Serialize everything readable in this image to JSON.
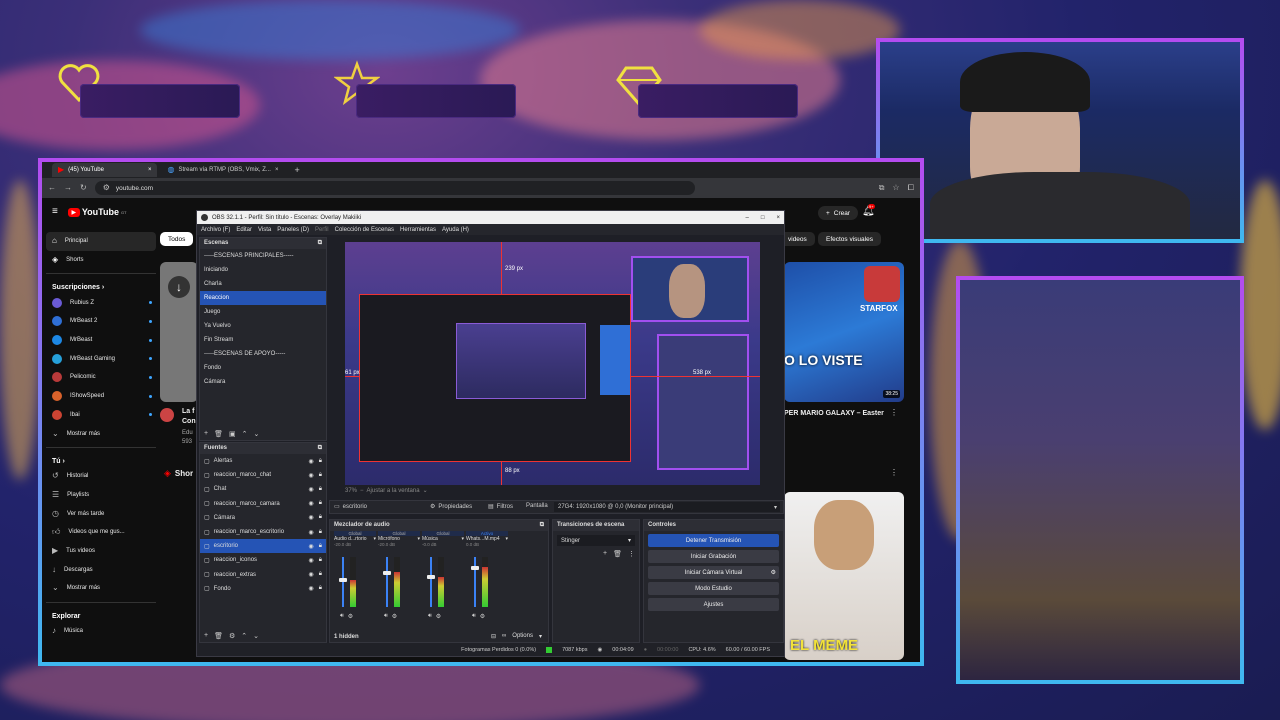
{
  "overlay": {
    "icons": [
      "heart-icon",
      "star-icon",
      "diamond-icon"
    ],
    "accent_purple": "#b44cf0",
    "accent_blue": "#3fb8f0"
  },
  "browser": {
    "tabs": [
      {
        "label": "(45) YouTube",
        "close": "×"
      },
      {
        "label": "Stream vía RTMP (OBS, Vmix, Z...",
        "close": "×"
      }
    ],
    "new_tab": "+",
    "url": "youtube.com"
  },
  "youtube": {
    "logo": "YouTube",
    "logo_sup": "GT",
    "create_label": "Crear",
    "notif_count": "9+",
    "nav": [
      {
        "label": "Principal",
        "icon": "home-icon"
      },
      {
        "label": "Shorts",
        "icon": "shorts-icon"
      }
    ],
    "subs_heading": "Suscripciones",
    "subs": [
      {
        "label": "Rubius Z",
        "color": "#6b5bd6"
      },
      {
        "label": "MrBeast 2",
        "color": "#2f6fd6"
      },
      {
        "label": "MrBeast",
        "color": "#1d88e5"
      },
      {
        "label": "MrBeast Gaming",
        "color": "#26a0da"
      },
      {
        "label": "Pelicomic",
        "color": "#b83a3a"
      },
      {
        "label": "IShowSpeed",
        "color": "#d9622b"
      },
      {
        "label": "Ibai",
        "color": "#c43"
      }
    ],
    "show_more": "Mostrar más",
    "you_heading": "Tú",
    "you_items": [
      {
        "label": "Historial",
        "icon": "history-icon"
      },
      {
        "label": "Playlists",
        "icon": "playlist-icon"
      },
      {
        "label": "Ver más tarde",
        "icon": "clock-icon"
      },
      {
        "label": "Videos que me gus...",
        "icon": "thumbs-up-icon"
      },
      {
        "label": "Tus videos",
        "icon": "video-icon"
      },
      {
        "label": "Descargas",
        "icon": "download-icon"
      },
      {
        "label": "Mostrar más",
        "icon": "chevron-down-icon"
      }
    ],
    "explore_heading": "Explorar",
    "explore_items": [
      {
        "label": "Música",
        "icon": "music-icon"
      }
    ],
    "chips": [
      "Todos",
      "videos",
      "Efectos visuales"
    ],
    "card_left_title": "La f",
    "card_left_sub": "Con",
    "card_left_meta1": "Edu",
    "card_left_meta2": "593",
    "shorts_label": "Shor",
    "card_right_title": "PER MARIO GALAXY – Easter",
    "thumb_text_starfox": "STARFOX",
    "thumb_text_lo_viste": "O LO VISTE",
    "thumb_duration": "38:25",
    "thumb_text_meme": "EL MEME"
  },
  "obs": {
    "title": "OBS 32.1.1 - Perfil: Sin título - Escenas: Overlay Makiiki",
    "menu": [
      "Archivo (F)",
      "Editar",
      "Vista",
      "Paneles (D)",
      "Perfil",
      "Colección de Escenas",
      "Herramientas",
      "Ayuda (H)"
    ],
    "scenes_heading": "Escenas",
    "scenes": [
      "-----ESCENAS PRINCIPALES-----",
      "Iniciando",
      "Charla",
      "Reaccion",
      "Juego",
      "Ya Vuelvo",
      "Fin Stream",
      "-----ESCENAS DE APOYO-----",
      "Fondo",
      "Cámara"
    ],
    "selected_scene": "Reaccion",
    "sources_heading": "Fuentes",
    "sources": [
      "Alertas",
      "reaccion_marco_chat",
      "Chat",
      "reaccion_marco_camara",
      "Cámara",
      "reaccion_marco_escritorio",
      "escritorio",
      "reaccion_iconos",
      "reaccion_extras",
      "Fondo"
    ],
    "selected_source": "escritorio",
    "preview_labels": {
      "top": "239 px",
      "left": "61 px",
      "right": "538 px",
      "bottom": "88 px"
    },
    "zoom_label": "37%",
    "zoom_hint": "Ajustar a la ventana",
    "toolbar": {
      "source_name": "escritorio",
      "properties": "Propiedades",
      "filters": "Filtros",
      "screen_label": "Pantalla",
      "screen_value": "27G4: 1920x1080 @ 0,0 (Monitor principal)"
    },
    "mixer_heading": "Mezclador de audio",
    "mixer_channels": [
      {
        "tag": "Global",
        "name": "Audio d...rtorio",
        "db": "-20.0 dB",
        "level": 0.55
      },
      {
        "tag": "Global",
        "name": "Micrófono",
        "db": "-20.0 dB",
        "level": 0.7
      },
      {
        "tag": "Global",
        "name": "Música",
        "db": "-0.0 dB",
        "level": 0.6
      },
      {
        "tag": "Activo",
        "name": "Whats...M.mp4",
        "db": "0.0 dB",
        "level": 0.8
      }
    ],
    "hidden_label": "1 hidden",
    "options_label": "Options",
    "transitions_heading": "Transiciones de escena",
    "transition_value": "Stinger",
    "controls_heading": "Controles",
    "controls": [
      "Detener Transmisión",
      "Iniciar Grabación",
      "Iniciar Cámara Virtual",
      "Modo Estudio",
      "Ajustes"
    ],
    "status": {
      "dropped": "Fotogramas Perdidos 0 (0.0%)",
      "bitrate": "7087 kbps",
      "live_time": "00:04:09",
      "rec_time": "00:00:00",
      "cpu": "CPU: 4.6%",
      "fps": "60.00 / 60.00 FPS"
    }
  }
}
